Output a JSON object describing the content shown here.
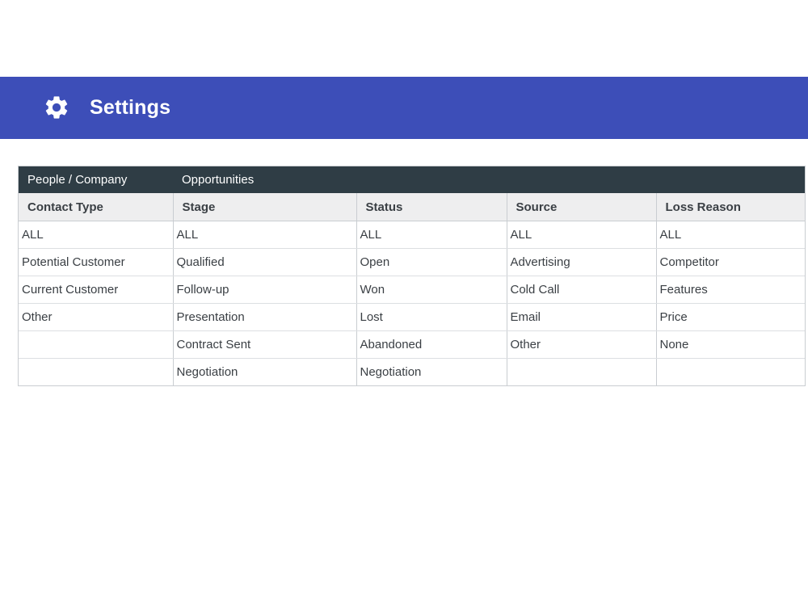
{
  "header": {
    "title": "Settings",
    "icon": "gear-icon",
    "background": "#3d4eb8"
  },
  "table": {
    "groups": [
      "People / Company",
      "Opportunities"
    ],
    "columns": [
      "Contact Type",
      "Stage",
      "Status",
      "Source",
      "Loss Reason"
    ],
    "rows": [
      [
        "ALL",
        "ALL",
        "ALL",
        "ALL",
        "ALL"
      ],
      [
        "Potential Customer",
        "Qualified",
        "Open",
        "Advertising",
        "Competitor"
      ],
      [
        "Current Customer",
        "Follow-up",
        "Won",
        "Cold Call",
        "Features"
      ],
      [
        "Other",
        "Presentation",
        "Lost",
        "Email",
        "Price"
      ],
      [
        "",
        "Contract Sent",
        "Abandoned",
        "Other",
        "None"
      ],
      [
        "",
        "Negotiation",
        "Negotiation",
        "",
        ""
      ]
    ]
  }
}
